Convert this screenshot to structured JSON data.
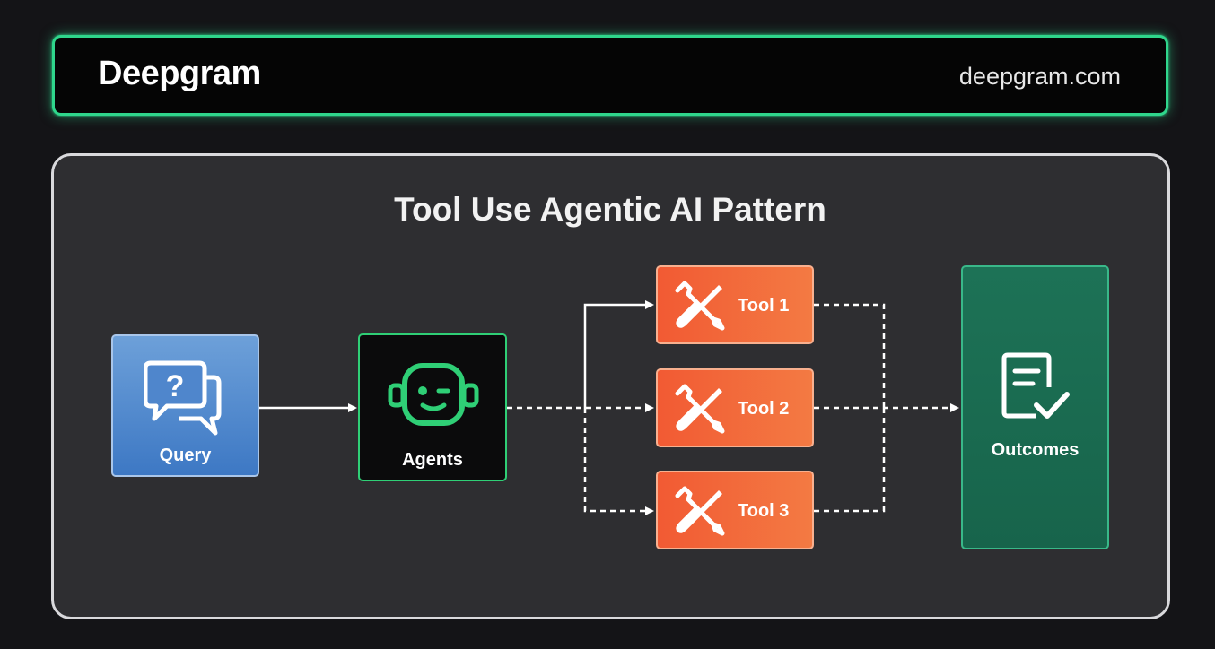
{
  "header": {
    "brand": "Deepgram",
    "website": "deepgram.com"
  },
  "diagram": {
    "title": "Tool Use Agentic AI Pattern",
    "nodes": {
      "query": {
        "label": "Query",
        "icon": "question-chat-icon"
      },
      "agents": {
        "label": "Agents",
        "icon": "robot-icon"
      },
      "tools": [
        {
          "label": "Tool 1",
          "icon": "wrench-screwdriver-icon"
        },
        {
          "label": "Tool 2",
          "icon": "wrench-screwdriver-icon"
        },
        {
          "label": "Tool 3",
          "icon": "wrench-screwdriver-icon"
        }
      ],
      "outcomes": {
        "label": "Outcomes",
        "icon": "checklist-icon"
      }
    },
    "edges": [
      {
        "from": "Query",
        "to": "Agents",
        "style": "solid"
      },
      {
        "from": "Agents",
        "to": "Tool 1",
        "style": "solid"
      },
      {
        "from": "Agents",
        "to": "Tool 2",
        "style": "dashed"
      },
      {
        "from": "Agents",
        "to": "Tool 3",
        "style": "dashed"
      },
      {
        "from": "Tool 1",
        "to": "Outcomes",
        "style": "dashed"
      },
      {
        "from": "Tool 2",
        "to": "Outcomes",
        "style": "dashed"
      },
      {
        "from": "Tool 3",
        "to": "Outcomes",
        "style": "dashed"
      }
    ]
  },
  "colors": {
    "brand_green": "#2fd68c",
    "query_blue": "#3d78c4",
    "agent_green": "#2fcf76",
    "tool_orange": "#f25a33",
    "outcome_teal": "#17644b"
  }
}
